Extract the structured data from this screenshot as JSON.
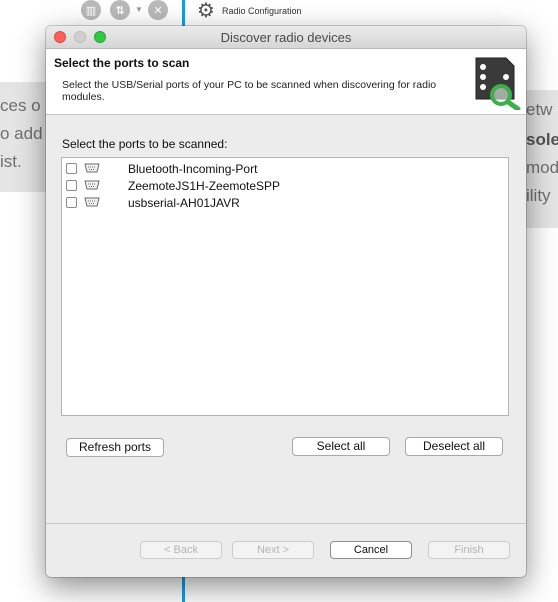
{
  "background": {
    "toolbar": {
      "icons": [
        "book-icon",
        "sort-icon",
        "close-circle-icon",
        "gear-icon"
      ],
      "title": "Radio Configuration"
    },
    "left_text": [
      "ces o",
      "o add",
      "ist."
    ],
    "right_text": [
      "etw",
      "sole",
      "mod",
      "ility"
    ]
  },
  "dialog": {
    "title": "Discover radio devices",
    "header": {
      "title": "Select the ports to scan",
      "description": "Select the USB/Serial ports of your PC to be scanned when discovering for radio modules.",
      "icon": "radio-module-search-icon"
    },
    "ports_label": "Select the ports to be scanned:",
    "ports": [
      {
        "label": "Bluetooth-Incoming-Port",
        "checked": false
      },
      {
        "label": "ZeemoteJS1H-ZeemoteSPP",
        "checked": false
      },
      {
        "label": "usbserial-AH01JAVR",
        "checked": false
      }
    ],
    "buttons": {
      "refresh": "Refresh ports",
      "select_all": "Select all",
      "deselect_all": "Deselect all",
      "back": "< Back",
      "next": "Next >",
      "cancel": "Cancel",
      "finish": "Finish"
    }
  },
  "colors": {
    "accent_blue": "#1e9ae0",
    "close": "#fc605b",
    "maximize": "#35c649",
    "icon_green": "#3cb04a",
    "icon_dark": "#3a3a3a"
  }
}
